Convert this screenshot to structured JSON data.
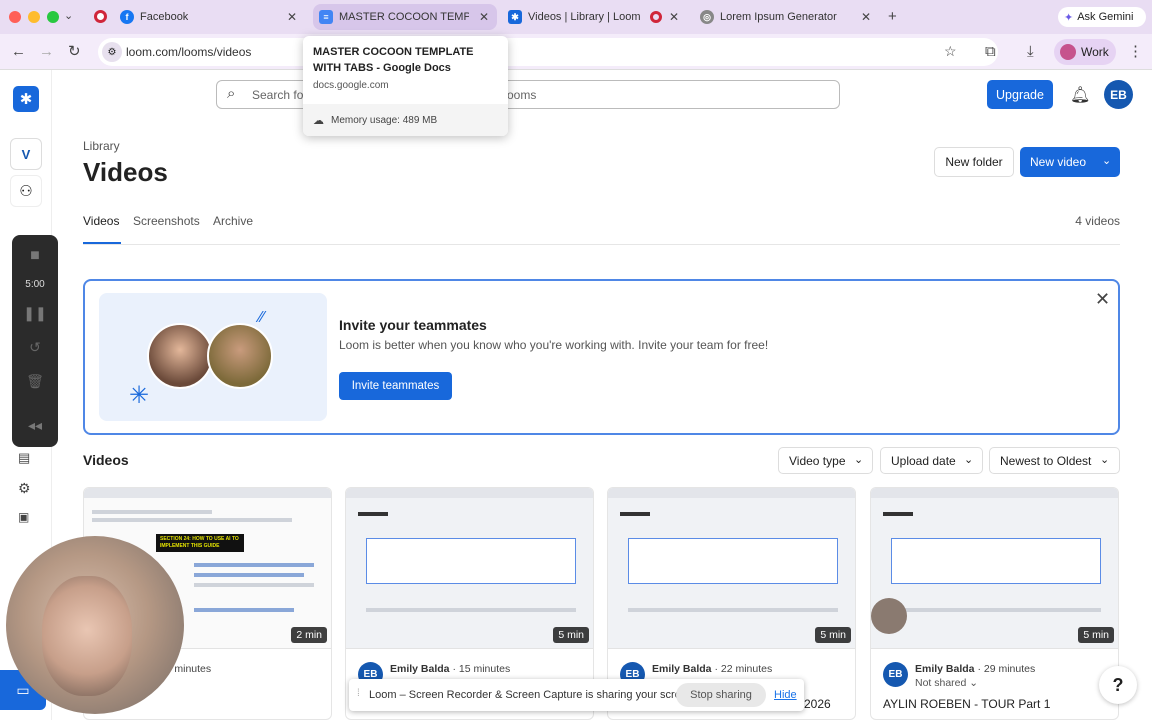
{
  "browser": {
    "tabs": [
      {
        "title": "Facebook",
        "icon": "facebook-icon"
      },
      {
        "title": "MASTER COCOON TEMPLATE",
        "icon": "google-docs-icon"
      },
      {
        "title": "Videos | Library | Loom",
        "icon": "loom-icon"
      },
      {
        "title": "Lorem Ipsum Generator",
        "icon": "globe-icon"
      }
    ],
    "gemini_label": "Ask Gemini",
    "url": "loom.com/looms/videos",
    "profile_label": "Work"
  },
  "tooltip": {
    "title": "MASTER COCOON TEMPLATE WITH TABS - Google Docs",
    "domain": "docs.google.com",
    "memory": "Memory usage: 489 MB"
  },
  "sidebar": {
    "workspace_initial": "V"
  },
  "header": {
    "search_placeholder": "Search fo",
    "search_placeholder_tail": "ooms",
    "upgrade_label": "Upgrade",
    "avatar_initials": "EB"
  },
  "page": {
    "breadcrumb": "Library",
    "title": "Videos",
    "new_folder": "New folder",
    "new_video": "New video",
    "tabs": [
      "Videos",
      "Screenshots",
      "Archive"
    ],
    "video_count": "4 videos"
  },
  "invite": {
    "title": "Invite your teammates",
    "description": "Loom is better when you know who you're working with. Invite your team for free!",
    "button": "Invite teammates"
  },
  "videos": {
    "heading": "Videos",
    "filters": [
      "Video type",
      "Upload date",
      "Newest to Oldest"
    ],
    "cards": [
      {
        "duration": "2 min",
        "initials": "",
        "author": "ba",
        "age": "7 minutes",
        "status": "red",
        "title": "",
        "thumb_text": "SECTION 24: HOW TO USE AI TO IMPLEMENT THIS GUIDE"
      },
      {
        "duration": "5 min",
        "initials": "EB",
        "author": "Emily Balda",
        "age": "15 minutes",
        "status": "",
        "title": ""
      },
      {
        "duration": "5 min",
        "initials": "EB",
        "author": "Emily Balda",
        "age": "22 minutes",
        "status": "",
        "title": "2026"
      },
      {
        "duration": "5 min",
        "initials": "EB",
        "author": "Emily Balda",
        "age": "29 minutes",
        "status": "Not shared",
        "title": "AYLIN ROEBEN - TOUR Part 1"
      }
    ]
  },
  "recorder": {
    "time": "5:00"
  },
  "sharebar": {
    "message": "Loom – Screen Recorder & Screen Capture is sharing your screen.",
    "stop": "Stop sharing",
    "hide": "Hide"
  },
  "help_label": "?",
  "colors": {
    "accent": "#1868db",
    "tab_strip": "#e9ddf3"
  }
}
